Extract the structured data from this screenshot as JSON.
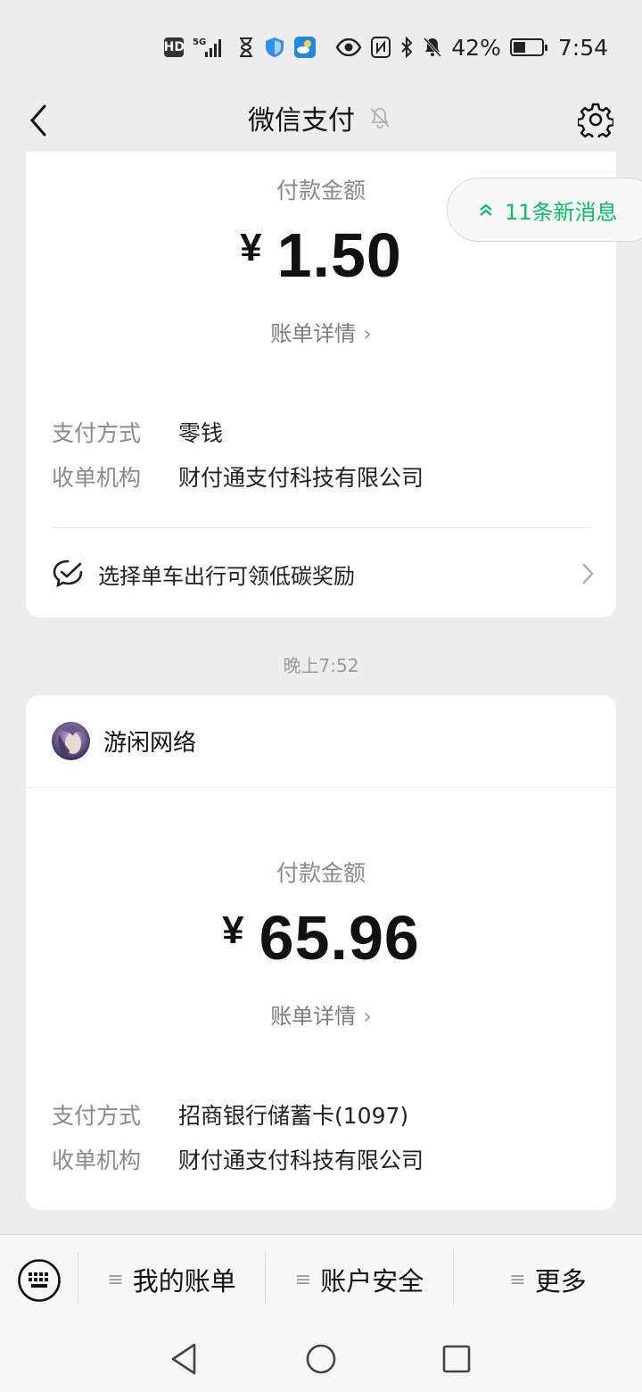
{
  "status_bar": {
    "hd": "HD",
    "network": "5G",
    "battery_percent": "42%",
    "battery_level": 0.42,
    "time": "7:54"
  },
  "header": {
    "title": "微信支付"
  },
  "new_messages": {
    "label": "11条新消息"
  },
  "payment1": {
    "amount_label": "付款金额",
    "currency": "¥",
    "amount": "1.50",
    "detail_link": "账单详情",
    "method_key": "支付方式",
    "method_value": "零钱",
    "org_key": "收单机构",
    "org_value": "财付通支付科技有限公司",
    "promo": "选择单车出行可领低碳奖励"
  },
  "timestamp": "晚上7:52",
  "payment2": {
    "merchant": "游闲网络",
    "amount_label": "付款金额",
    "currency": "¥",
    "amount": "65.96",
    "detail_link": "账单详情",
    "method_key": "支付方式",
    "method_value": "招商银行储蓄卡(1097)",
    "org_key": "收单机构",
    "org_value": "财付通支付科技有限公司"
  },
  "menu": {
    "items": [
      {
        "label": "我的账单"
      },
      {
        "label": "账户安全"
      },
      {
        "label": "更多"
      }
    ],
    "hamburger": "≡"
  },
  "colors": {
    "accent_green": "#07c160",
    "background": "#ededed",
    "card": "#ffffff"
  }
}
